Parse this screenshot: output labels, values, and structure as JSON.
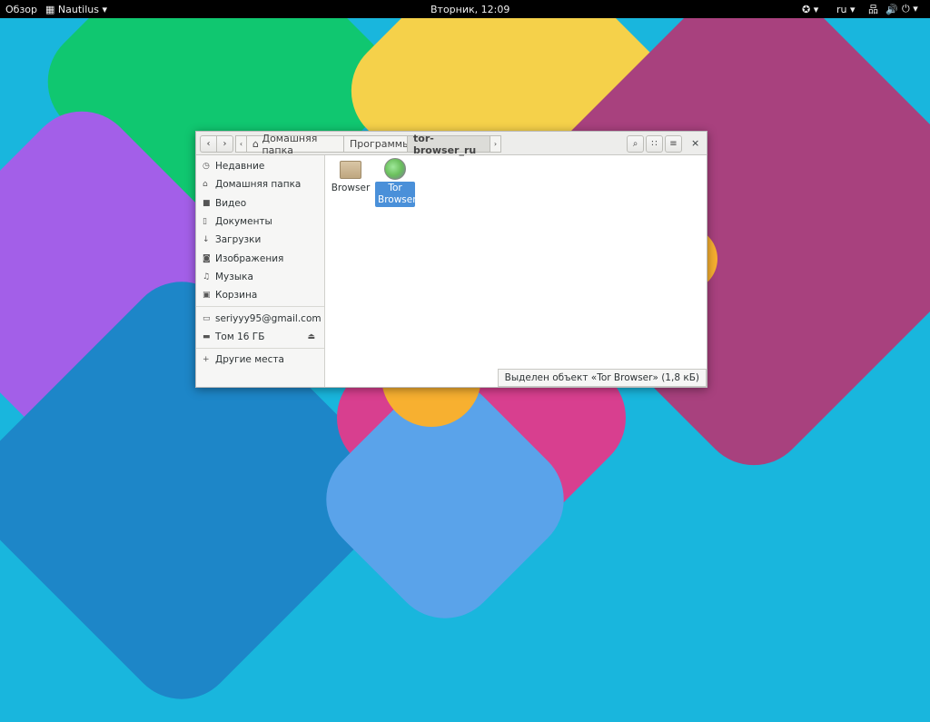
{
  "topbar": {
    "activities": "Обзор",
    "app_menu": "Nautilus",
    "clock": "Вторник, 12:09",
    "language": "ru"
  },
  "window": {
    "breadcrumbs": [
      "Домашняя папка",
      "Программы",
      "tor-browser_ru"
    ],
    "sidebar": [
      "Недавние",
      "Домашняя папка",
      "Видео",
      "Документы",
      "Загрузки",
      "Изображения",
      "Музыка",
      "Корзина"
    ],
    "accounts": [
      "seriyyy95@gmail.com",
      "Том 16 ГБ"
    ],
    "other": "Другие места",
    "files": [
      {
        "name": "Browser",
        "type": "folder"
      },
      {
        "name": "Tor Browser",
        "type": "launcher",
        "selected": true
      }
    ],
    "status": "Выделен объект «Tor Browser» (1,8 кБ)"
  },
  "colors": {
    "selection": "#4a90d9",
    "desktop": "#19b6dd"
  }
}
